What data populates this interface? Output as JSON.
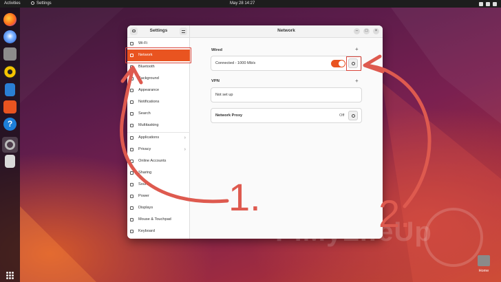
{
  "topbar": {
    "activities": "Activities",
    "app_name": "Settings",
    "clock": "May 28  14:27"
  },
  "dock": {
    "icons": [
      "firefox-icon",
      "thunderbird-icon",
      "files-icon",
      "rhythmbox-icon",
      "writer-icon",
      "software-icon",
      "help-icon",
      "settings-icon",
      "trash-icon",
      "app-grid-icon"
    ]
  },
  "window": {
    "sidebar_title": "Settings",
    "main_title": "Network",
    "sidebar_items": [
      {
        "label": "Wi-Fi",
        "icon": "wifi-icon"
      },
      {
        "label": "Network",
        "icon": "network-icon"
      },
      {
        "label": "Bluetooth",
        "icon": "bluetooth-icon"
      },
      {
        "label": "Background",
        "icon": "background-icon"
      },
      {
        "label": "Appearance",
        "icon": "appearance-icon"
      },
      {
        "label": "Notifications",
        "icon": "bell-icon"
      },
      {
        "label": "Search",
        "icon": "search-icon"
      },
      {
        "label": "Multitasking",
        "icon": "multitasking-icon"
      },
      {
        "label": "Applications",
        "icon": "applications-icon"
      },
      {
        "label": "Privacy",
        "icon": "privacy-icon"
      },
      {
        "label": "Online Accounts",
        "icon": "online-accounts-icon"
      },
      {
        "label": "Sharing",
        "icon": "sharing-icon"
      },
      {
        "label": "Sound",
        "icon": "sound-icon"
      },
      {
        "label": "Power",
        "icon": "power-icon"
      },
      {
        "label": "Displays",
        "icon": "displays-icon"
      },
      {
        "label": "Mouse & Touchpad",
        "icon": "mouse-icon"
      },
      {
        "label": "Keyboard",
        "icon": "keyboard-icon"
      }
    ],
    "wired": {
      "label": "Wired",
      "add": "+",
      "connection_text": "Connected - 1000 Mb/s",
      "toggle_on": true
    },
    "vpn": {
      "label": "VPN",
      "add": "+",
      "status": "Not set up"
    },
    "proxy": {
      "label": "Network Proxy",
      "state": "Off"
    }
  },
  "annotations": {
    "step1": "1.",
    "step2": "2."
  },
  "desktop": {
    "home_label": "Home",
    "watermark": "PiMyLifeUp"
  },
  "colors": {
    "accent": "#e95420",
    "annotation": "#d9453b",
    "topbar": "#1d1d1d"
  }
}
